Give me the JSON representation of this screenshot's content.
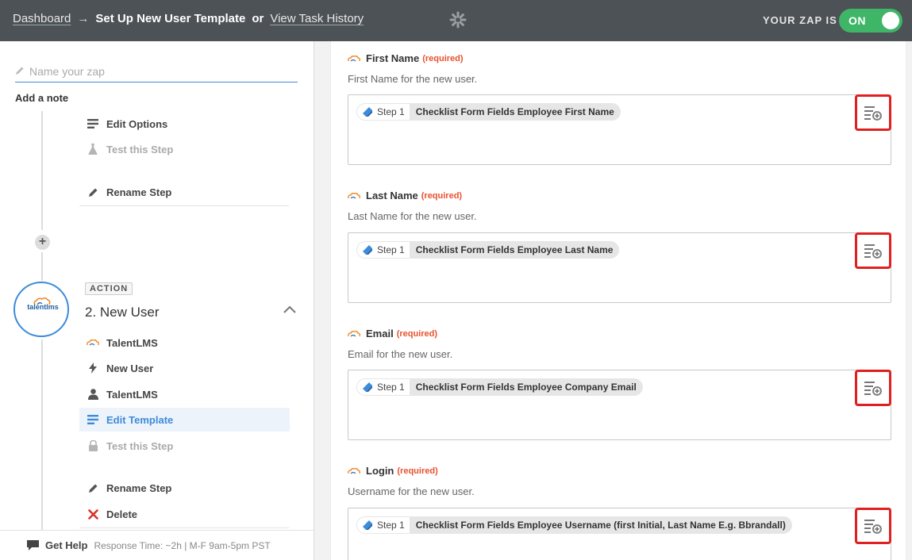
{
  "header": {
    "dashboard": "Dashboard",
    "arrow": "→",
    "title": "Set Up New User Template",
    "or": "or",
    "history": "View Task History",
    "zap_label": "YOUR ZAP IS",
    "toggle": "ON"
  },
  "left": {
    "zap_name_placeholder": "Name your zap",
    "add_note": "Add a note",
    "step1_menu": [
      {
        "label": "Edit Options",
        "icon": "list-icon"
      },
      {
        "label": "Test this Step",
        "icon": "flask-icon"
      },
      {
        "label": "Rename Step",
        "icon": "pencil-icon"
      }
    ],
    "action_badge": "ACTION",
    "app_logo": "talentlms",
    "step2_title": "2. New User",
    "step2_menu": [
      {
        "label": "TalentLMS",
        "icon": "talentlms-icon"
      },
      {
        "label": "New User",
        "icon": "bolt-icon"
      },
      {
        "label": "TalentLMS",
        "icon": "user-icon"
      },
      {
        "label": "Edit Template",
        "icon": "list-icon"
      },
      {
        "label": "Test this Step",
        "icon": "lock-icon"
      },
      {
        "label": "Rename Step",
        "icon": "pencil-icon"
      },
      {
        "label": "Delete",
        "icon": "x-icon"
      }
    ],
    "help": {
      "label": "Get Help",
      "response": "Response Time: ~2h | M-F 9am-5pm PST"
    }
  },
  "fields": [
    {
      "label": "First Name",
      "required": "(required)",
      "desc": "First Name for the new user.",
      "step": "Step 1",
      "value": "Checklist Form Fields Employee First Name"
    },
    {
      "label": "Last Name",
      "required": "(required)",
      "desc": "Last Name for the new user.",
      "step": "Step 1",
      "value": "Checklist Form Fields Employee Last Name"
    },
    {
      "label": "Email",
      "required": "(required)",
      "desc": "Email for the new user.",
      "step": "Step 1",
      "value": "Checklist Form Fields Employee Company Email"
    },
    {
      "label": "Login",
      "required": "(required)",
      "desc": "Username for the new user.",
      "step": "Step 1",
      "value": "Checklist Form Fields Employee Username (first Initial, Last Name E.g. Bbrandall)"
    }
  ],
  "colors": {
    "accent": "#3d8bd9",
    "toggle_on": "#3fb567",
    "required": "#e8512f",
    "highlight": "#e02020"
  }
}
